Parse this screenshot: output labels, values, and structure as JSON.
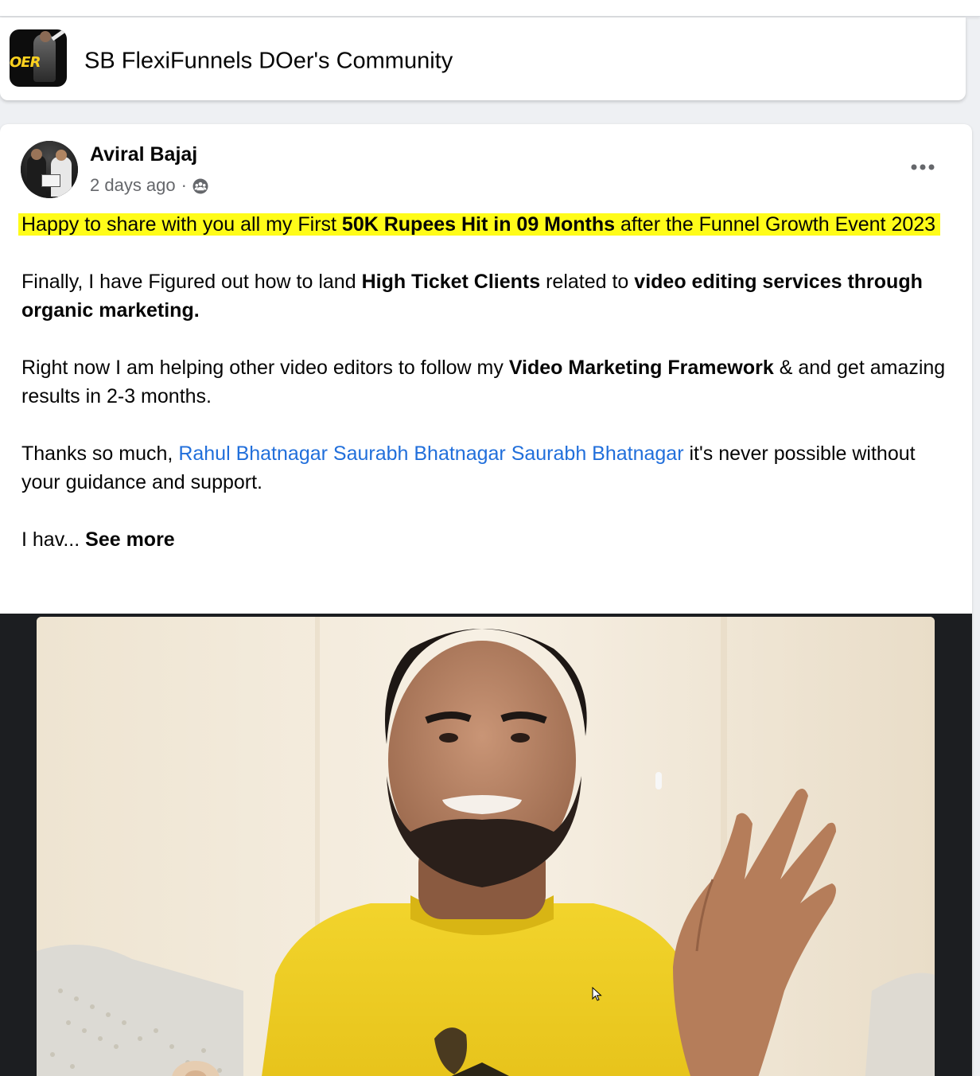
{
  "group": {
    "name": "SB FlexiFunnels DOer's Community",
    "icon_text": "OER"
  },
  "post": {
    "author": "Aviral Bajaj",
    "timestamp": "2 days ago",
    "separator": "·",
    "privacy_icon": "members-privacy-icon",
    "more_icon": "more-horizontal-icon",
    "paragraphs": {
      "p1": {
        "t1": "Happy to share with you all my First ",
        "b1": "50K Rupees Hit in 09 Months",
        "t2": " after the Funnel Growth Event 2023"
      },
      "p2": {
        "t1": "Finally, I have Figured out how to land ",
        "b1": "High Ticket Clients",
        "t2": " related to ",
        "b2": "video editing services through organic marketing."
      },
      "p3": {
        "t1": "Right now I am helping other video editors to follow my ",
        "b1": "Video Marketing Framework",
        "t2": " & and get amazing results in 2-3 months."
      },
      "p4": {
        "t1": "Thanks so much, ",
        "mention1": "Rahul Bhatnagar",
        "mention2": "Saurabh Bhatnagar",
        "mention3": "Saurabh Bhatnagar",
        "t2": " it's never possible without your guidance and support."
      },
      "p5": {
        "t1": "I hav... ",
        "see_more": "See more"
      }
    },
    "video": {
      "options_icon": "video-options-icon",
      "cursor_icon": "mouse-pointer-icon"
    }
  },
  "colors": {
    "highlight": "#fffc19",
    "mention": "#216fdb",
    "meta": "#65676b",
    "page_bg": "#eef0f3"
  }
}
